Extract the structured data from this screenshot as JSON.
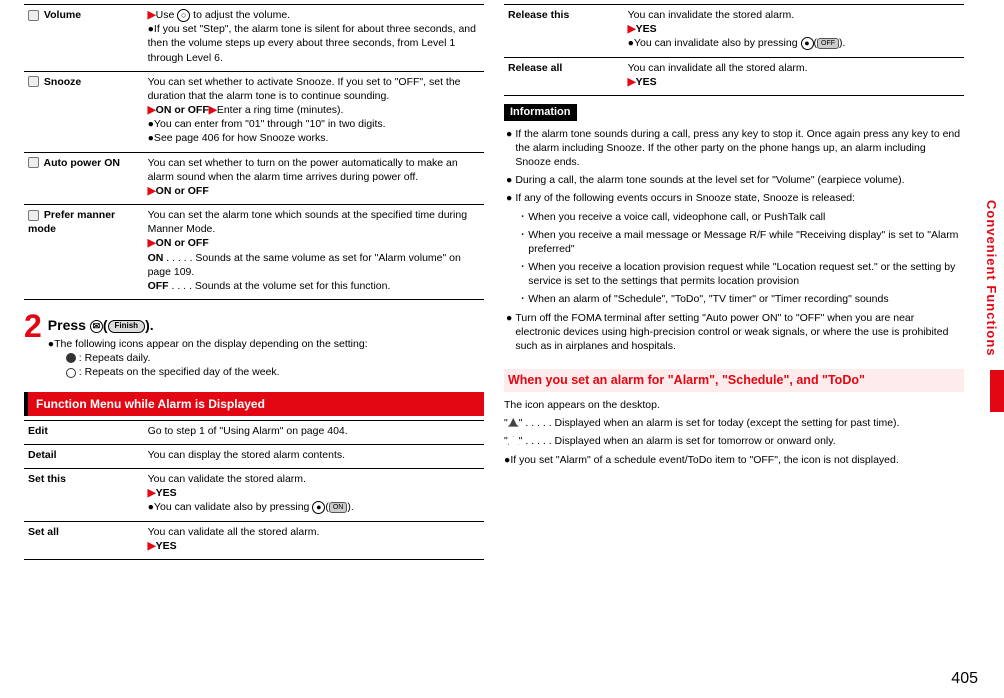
{
  "left": {
    "rows": [
      {
        "label": "Volume",
        "body": "▶Use ◯ to adjust the volume.\n●If you set \"Step\", the alarm tone is silent for about three seconds, and then the volume steps up every about three seconds, from Level 1 through Level 6."
      },
      {
        "label": "Snooze",
        "body": "You can set whether to activate Snooze. If you set to \"OFF\", set the duration that the alarm tone is to continue sounding.\n▶ON or OFF▶Enter a ring time (minutes).\n●You can enter from \"01\" through \"10\" in two digits.\n●See page 406 for how Snooze works."
      },
      {
        "label": "Auto power ON",
        "body": "You can set whether to turn on the power automatically to make an alarm sound when the alarm time arrives during power off.\n▶ON or OFF"
      },
      {
        "label": "Prefer manner mode",
        "body": "You can set the alarm tone which sounds at the specified time during Manner Mode.\n▶ON or OFF\nON . . . . . Sounds at the same volume as set for \"Alarm volume\" on page 109.\nOFF . . . . Sounds at the volume set for this function."
      }
    ],
    "step": {
      "number": "2",
      "title_a": "Press",
      "title_b": "(",
      "pill": "Finish",
      "title_c": ").",
      "note": "●The following icons appear on the display depending on the setting:",
      "daily": ": Repeats daily.",
      "weekly": ": Repeats on the specified day of the week."
    },
    "func_menu_header": "Function Menu while Alarm is Displayed",
    "func_menu": [
      {
        "label": "Edit",
        "body": "Go to step 1 of \"Using Alarm\" on page 404."
      },
      {
        "label": "Detail",
        "body": "You can display the stored alarm contents."
      },
      {
        "label": "Set this",
        "body": "You can validate the stored alarm.\n▶YES\n●You can validate also by pressing ◯(  ON  )."
      },
      {
        "label": "Set all",
        "body": "You can validate all the stored alarm.\n▶YES"
      }
    ]
  },
  "right": {
    "top_rows": [
      {
        "label": "Release this",
        "body": "You can invalidate the stored alarm.\n▶YES\n●You can invalidate also by pressing ◯( OFF )."
      },
      {
        "label": "Release all",
        "body": "You can invalidate all the stored alarm.\n▶YES"
      }
    ],
    "info_header": "Information",
    "info": [
      "If the alarm tone sounds during a call, press any key to stop it. Once again press any key to end the alarm including Snooze. If the other party on the phone hangs up, an alarm including Snooze ends.",
      "During a call, the alarm tone sounds at the level set for \"Volume\" (earpiece volume).",
      "If any of the following events occurs in Snooze state, Snooze is released:",
      "Turn off the FOMA terminal after setting \"Auto power ON\" to \"OFF\" when you are near electronic devices using high-precision control or weak signals, or where the use is prohibited such as in airplanes and hospitals."
    ],
    "info_sub": [
      "When you receive a voice call, videophone call, or PushTalk call",
      "When you receive a mail message or Message R/F while \"Receiving display\" is set to \"Alarm preferred\"",
      "When you receive a location provision request while \"Location request set.\" or the setting by service is set to the settings that permits location provision",
      "When an alarm of \"Schedule\", \"ToDo\", \"TV timer\" or \"Timer recording\" sounds"
    ],
    "when_header": "When you set an alarm for \"Alarm\", \"Schedule\", and \"ToDo\"",
    "desktop_line": "The icon appears on the desktop.",
    "today_line": "\" . . . . . Displayed when an alarm is set for today (except the setting for past time).",
    "onward_line": "\" . . . . . Displayed when an alarm is set for tomorrow or onward only.",
    "final_note": "●If you set \"Alarm\" of a schedule event/ToDo item to \"OFF\", the icon is not displayed."
  },
  "side_tab": "Convenient Functions",
  "page_number": "405"
}
